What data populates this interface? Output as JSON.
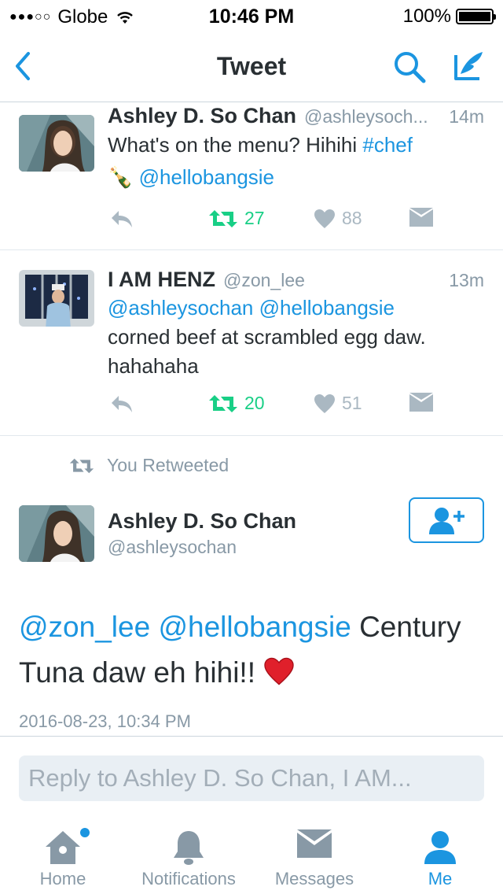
{
  "status_bar": {
    "signal": "●●●○○",
    "carrier": "Globe",
    "time": "10:46 PM",
    "battery_label": "100%",
    "battery_level": 1.0
  },
  "nav": {
    "title": "Tweet",
    "icons": [
      "back-chevron-icon",
      "search-icon",
      "compose-icon"
    ]
  },
  "tweets": [
    {
      "name": "Ashley D. So Chan",
      "handle": "@ashleysoch...",
      "time": "14m",
      "line1_text": "What's on the menu? Hihihi ",
      "line1_link": "#chef",
      "line2_emoji": "🍾",
      "line2_link": "@hellobangsie",
      "retweets": "27",
      "likes": "88"
    },
    {
      "name": "I AM HENZ",
      "handle": "@zon_lee",
      "time": "13m",
      "line1_links": "@ashleysochan @hellobangsie",
      "line2_text": "corned beef at scrambled egg daw.",
      "line3_text": "hahahaha",
      "retweets": "20",
      "likes": "51"
    }
  ],
  "retweet_banner": "You Retweeted",
  "main_tweet": {
    "name": "Ashley D. So Chan",
    "handle": "@ashleysochan",
    "link1": "@zon_lee",
    "link2": "@hellobangsie",
    "text_after": " Century",
    "line2_text": "Tuna daw eh hihi!! ",
    "emoji": "❤️",
    "date": "2016-08-23, 10:34 PM"
  },
  "reply": {
    "placeholder": "Reply to Ashley D. So Chan, I AM..."
  },
  "tabs": [
    {
      "label": "Home",
      "icon": "home-icon",
      "active": false,
      "has_badge": true
    },
    {
      "label": "Notifications",
      "icon": "bell-icon",
      "active": false
    },
    {
      "label": "Messages",
      "icon": "envelope-icon",
      "active": false
    },
    {
      "label": "Me",
      "icon": "person-icon",
      "active": true
    }
  ],
  "colors": {
    "accent": "#1b95e0",
    "retweet_green": "#19cf86",
    "muted": "#8899a6",
    "text": "#292f33",
    "action_gray": "#aab8c2"
  }
}
